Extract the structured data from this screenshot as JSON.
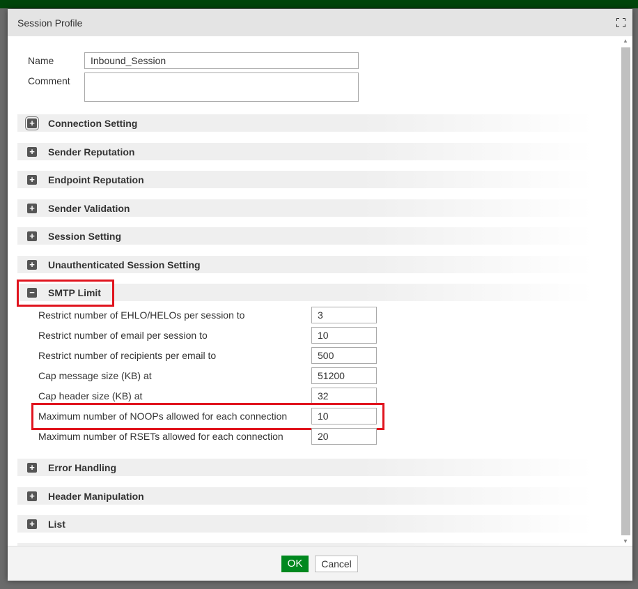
{
  "dialog": {
    "title": "Session Profile"
  },
  "form": {
    "name_label": "Name",
    "name_value": "Inbound_Session",
    "comment_label": "Comment",
    "comment_value": ""
  },
  "sections": {
    "connection": "Connection Setting",
    "sender_rep": "Sender Reputation",
    "endpoint_rep": "Endpoint Reputation",
    "sender_val": "Sender Validation",
    "session": "Session Setting",
    "unauth": "Unauthenticated Session Setting",
    "smtp": "SMTP Limit",
    "error": "Error Handling",
    "header": "Header Manipulation",
    "list": "List"
  },
  "smtp_limit": [
    {
      "label": "Restrict number of EHLO/HELOs per session to",
      "value": "3"
    },
    {
      "label": "Restrict number of email per session to",
      "value": "10"
    },
    {
      "label": "Restrict number of recipients per email to",
      "value": "500"
    },
    {
      "label": "Cap message size (KB) at",
      "value": "51200"
    },
    {
      "label": "Cap header size (KB) at",
      "value": "32"
    },
    {
      "label": "Maximum number of NOOPs allowed for each connection",
      "value": "10"
    },
    {
      "label": "Maximum number of RSETs allowed for each connection",
      "value": "20"
    }
  ],
  "footer": {
    "ok": "OK",
    "cancel": "Cancel"
  },
  "colors": {
    "accent": "#00881e",
    "highlight": "#e0141e",
    "topbar": "#00450a"
  }
}
